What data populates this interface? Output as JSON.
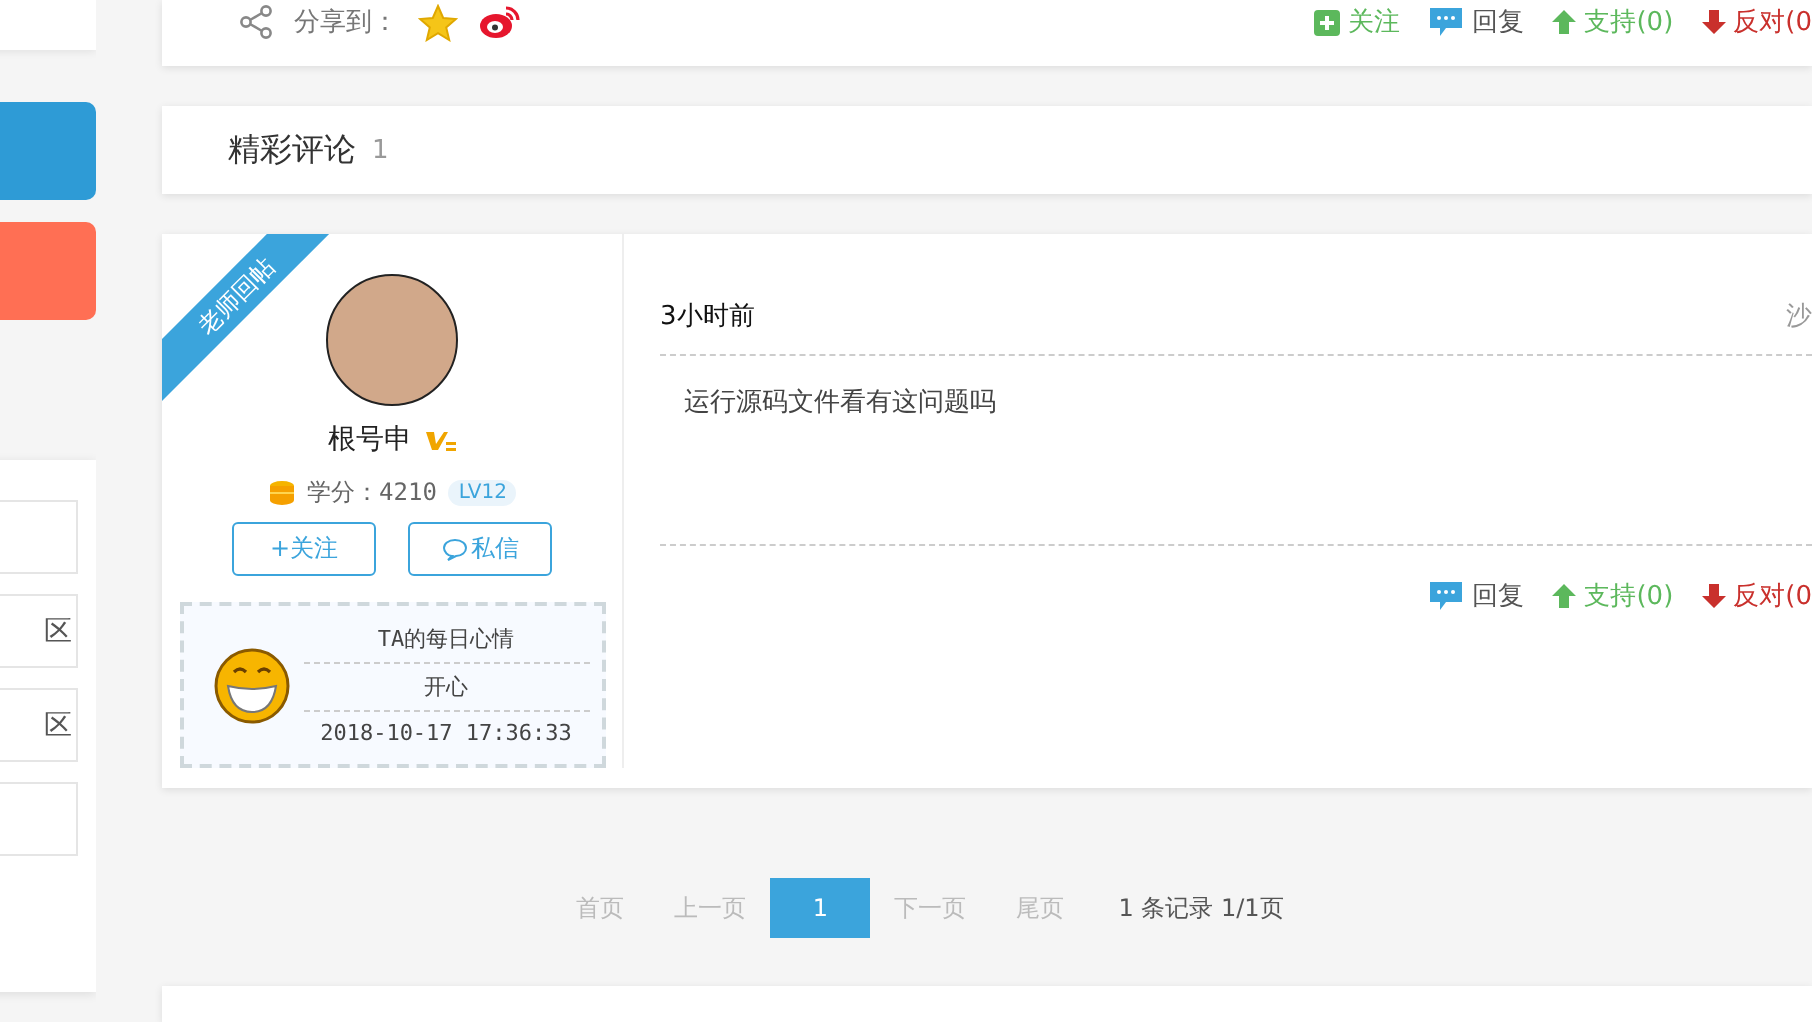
{
  "sidebar": {
    "links": [
      {
        "kind": "blank"
      },
      {
        "kind": "link",
        "label": "区"
      },
      {
        "kind": "link",
        "label": "区"
      },
      {
        "kind": "blank"
      }
    ]
  },
  "post_bar": {
    "share_label": "分享到：",
    "actions": [
      {
        "kind": "follow",
        "label": "关注"
      },
      {
        "kind": "reply",
        "label": "回复"
      },
      {
        "kind": "support",
        "label": "支持(0)"
      },
      {
        "kind": "oppose",
        "label": "反对(0"
      }
    ]
  },
  "comments_header": {
    "title": "精彩评论",
    "count": "1"
  },
  "comment": {
    "ribbon": "老师回帖",
    "user": {
      "name": "根号申",
      "score": "学分：4210",
      "level": "LV12"
    },
    "buttons": [
      {
        "kind": "follow",
        "label": "+关注"
      },
      {
        "kind": "message",
        "label": "私信"
      }
    ],
    "mood": {
      "title": "TA的每日心情",
      "value": "开心",
      "time": "2018-10-17 17:36:33"
    },
    "time": "3小时前",
    "floor": "沙",
    "text": "运行源码文件看有这问题吗",
    "actions": [
      {
        "kind": "reply",
        "label": "回复"
      },
      {
        "kind": "support",
        "label": "支持(0)"
      },
      {
        "kind": "oppose",
        "label": "反对(0"
      }
    ]
  },
  "pagination": {
    "pages": [
      {
        "label": "首页",
        "selected": false
      },
      {
        "label": "上一页",
        "selected": false
      },
      {
        "label": "1",
        "selected": true
      },
      {
        "label": "下一页",
        "selected": false
      },
      {
        "label": "尾页",
        "selected": false
      }
    ],
    "summary": "1 条记录 1/1页"
  }
}
